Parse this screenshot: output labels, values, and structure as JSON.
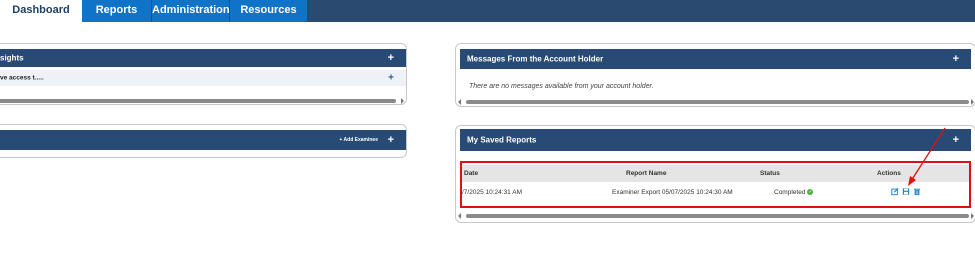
{
  "nav": {
    "tabs": [
      "Dashboard",
      "Reports",
      "Administration",
      "Resources"
    ]
  },
  "insights_panel": {
    "title": "sights",
    "plus": "+",
    "row_text": "ve access t.....",
    "row_plus": "+"
  },
  "examinees_panel": {
    "add_label": "+ Add Examinee",
    "plus": "+"
  },
  "messages_panel": {
    "title": "Messages From the Account Holder",
    "plus": "+",
    "message": "There are no messages available from your account holder."
  },
  "saved_reports_panel": {
    "title": "My Saved Reports",
    "plus": "+",
    "columns": [
      "Date",
      "Report Name",
      "Status",
      "Actions"
    ],
    "rows": [
      {
        "date": "/7/2025 10:24:31 AM",
        "report_name": "Examiner Export 05/07/2025 10:24:30 AM",
        "status": "Completed"
      }
    ],
    "action_icons": [
      "edit-icon",
      "save-icon",
      "trash-icon"
    ]
  },
  "colors": {
    "nav_bg": "#2a4a70",
    "tab_blue": "#0f73c8",
    "panel_header": "#274b74",
    "annotation_red": "#e01010",
    "status_green": "#46b23c"
  }
}
